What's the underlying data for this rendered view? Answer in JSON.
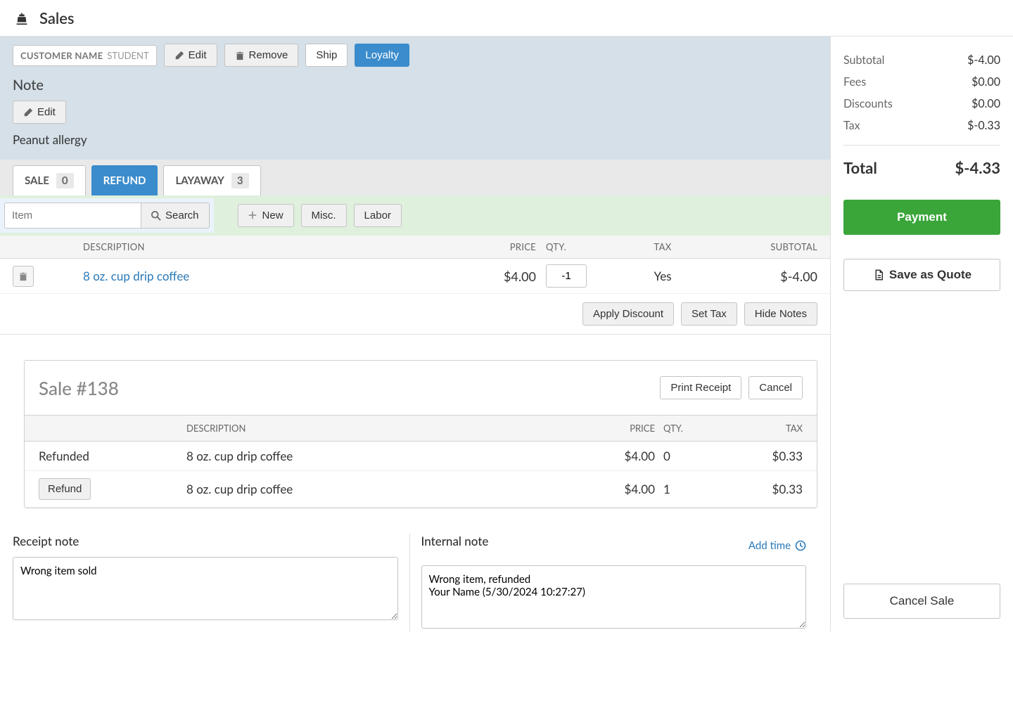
{
  "header": {
    "title": "Sales"
  },
  "customer": {
    "label": "CUSTOMER NAME",
    "name": "STUDENT",
    "edit": "Edit",
    "remove": "Remove",
    "ship": "Ship",
    "loyalty": "Loyalty"
  },
  "note": {
    "heading": "Note",
    "edit": "Edit",
    "text": "Peanut allergy"
  },
  "tabs": {
    "sale": {
      "label": "SALE",
      "count": "0"
    },
    "refund": {
      "label": "REFUND"
    },
    "layaway": {
      "label": "LAYAWAY",
      "count": "3"
    }
  },
  "search": {
    "placeholder": "Item",
    "search_btn": "Search",
    "new_btn": "New",
    "misc_btn": "Misc.",
    "labor_btn": "Labor"
  },
  "table": {
    "headers": {
      "desc": "DESCRIPTION",
      "price": "PRICE",
      "qty": "QTY.",
      "tax": "TAX",
      "sub": "SUBTOTAL"
    },
    "rows": [
      {
        "desc": "8 oz. cup drip coffee",
        "price": "$4.00",
        "qty": "-1",
        "tax": "Yes",
        "sub": "$-4.00"
      }
    ],
    "apply_discount": "Apply Discount",
    "set_tax": "Set Tax",
    "hide_notes": "Hide Notes"
  },
  "sale_card": {
    "title_prefix": "Sale ",
    "title_num": "#138",
    "print": "Print Receipt",
    "cancel": "Cancel",
    "headers": {
      "desc": "DESCRIPTION",
      "price": "PRICE",
      "qty": "QTY.",
      "tax": "TAX"
    },
    "rows": [
      {
        "status": "Refunded",
        "desc": "8 oz. cup drip coffee",
        "price": "$4.00",
        "qty": "0",
        "tax": "$0.33"
      },
      {
        "status_btn": "Refund",
        "desc": "8 oz. cup drip coffee",
        "price": "$4.00",
        "qty": "1",
        "tax": "$0.33"
      }
    ]
  },
  "receipt_note": {
    "heading": "Receipt note",
    "value": "Wrong item sold"
  },
  "internal_note": {
    "heading": "Internal note",
    "add_time": "Add time",
    "value": "Wrong item, refunded\nYour Name (5/30/2024 10:27:27)"
  },
  "summary": {
    "subtotal_label": "Subtotal",
    "subtotal": "$-4.00",
    "fees_label": "Fees",
    "fees": "$0.00",
    "discounts_label": "Discounts",
    "discounts": "$0.00",
    "tax_label": "Tax",
    "tax": "$-0.33",
    "total_label": "Total",
    "total": "$-4.33",
    "payment": "Payment",
    "save_quote": "Save as Quote",
    "cancel_sale": "Cancel Sale"
  }
}
